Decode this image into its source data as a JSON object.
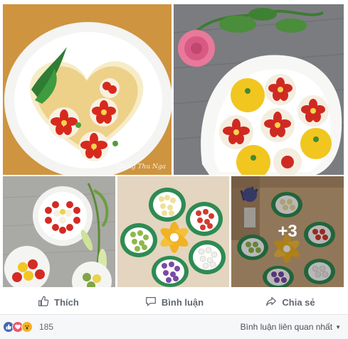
{
  "photos": {
    "watermark": "Giang Thu Nga",
    "more_count": "+3"
  },
  "actions": {
    "like_label": "Thích",
    "comment_label": "Bình luận",
    "share_label": "Chia sẻ"
  },
  "footer": {
    "reaction_count": "185",
    "sort_label": "Bình luận liên quan nhất"
  },
  "colors": {
    "like_blue": "#4267b2",
    "love_red": "#f25268",
    "wow_yellow": "#f7b125"
  },
  "icons": [
    "thumbs-up-icon",
    "comment-icon",
    "share-icon",
    "like-reaction-icon",
    "love-reaction-icon",
    "wow-reaction-icon",
    "chevron-down-icon"
  ]
}
